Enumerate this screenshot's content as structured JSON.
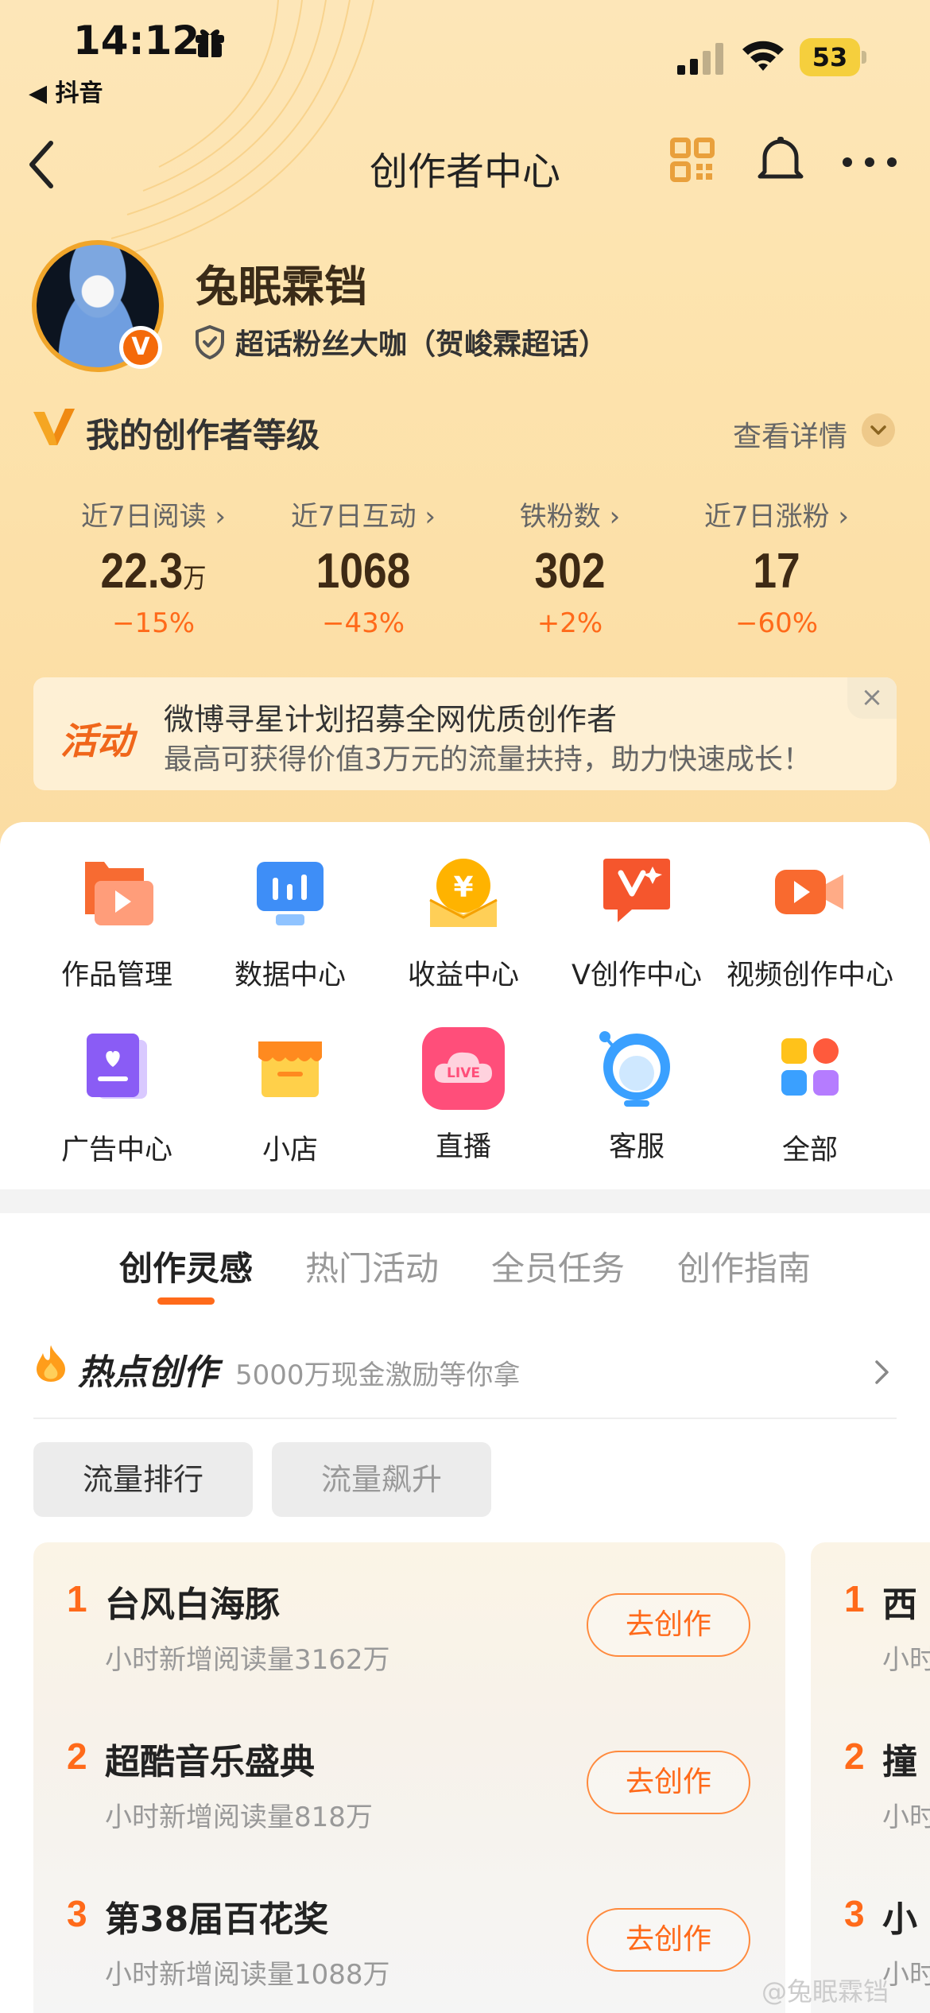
{
  "status_bar": {
    "time": "14:12",
    "back_app": "◀ 抖音",
    "battery": "53"
  },
  "nav": {
    "title": "创作者中心"
  },
  "profile": {
    "name": "兔眠霖铛",
    "verified_badge": "V",
    "fan_title": "超话粉丝大咖（贺峻霖超话）"
  },
  "level": {
    "title": "我的创作者等级",
    "detail": "查看详情"
  },
  "stats": [
    {
      "label": "近7日阅读 ›",
      "value": "22.3",
      "unit": "万",
      "change": "−15%"
    },
    {
      "label": "近7日互动 ›",
      "value": "1068",
      "unit": "",
      "change": "−43%"
    },
    {
      "label": "铁粉数 ›",
      "value": "302",
      "unit": "",
      "change": "+2%"
    },
    {
      "label": "近7日涨粉 ›",
      "value": "17",
      "unit": "",
      "change": "−60%"
    }
  ],
  "banner": {
    "tag": "活动",
    "line1": "微博寻星计划招募全网优质创作者",
    "line2": "最高可获得价值3万元的流量扶持，助力快速成长！",
    "close": "×"
  },
  "tools": [
    {
      "label": "作品管理",
      "icon": "works-icon"
    },
    {
      "label": "数据中心",
      "icon": "data-icon"
    },
    {
      "label": "收益中心",
      "icon": "income-icon"
    },
    {
      "label": "V创作中心",
      "icon": "v-create-icon"
    },
    {
      "label": "视频创作中心",
      "icon": "video-icon"
    },
    {
      "label": "广告中心",
      "icon": "ad-icon"
    },
    {
      "label": "小店",
      "icon": "shop-icon"
    },
    {
      "label": "直播",
      "icon": "live-icon",
      "icon_text": "LIVE"
    },
    {
      "label": "客服",
      "icon": "service-icon"
    },
    {
      "label": "全部",
      "icon": "all-icon"
    }
  ],
  "tabs": [
    "创作灵感",
    "热门活动",
    "全员任务",
    "创作指南"
  ],
  "hot": {
    "title": "热点创作",
    "subtitle": "5000万现金激励等你拿"
  },
  "filters": [
    "流量排行",
    "流量飙升"
  ],
  "ranking": [
    {
      "rank": "1",
      "title": "台风白海豚",
      "sub": "小时新增阅读量3162万",
      "button": "去创作"
    },
    {
      "rank": "2",
      "title": "超酷音乐盛典",
      "sub": "小时新增阅读量818万",
      "button": "去创作"
    },
    {
      "rank": "3",
      "title": "第38届百花奖",
      "sub": "小时新增阅读量1088万",
      "button": "去创作"
    }
  ],
  "ranking2": [
    {
      "rank": "1",
      "title": "西 ",
      "sub": "小时"
    },
    {
      "rank": "2",
      "title": "撞 ",
      "sub": "小时"
    },
    {
      "rank": "3",
      "title": "小 ",
      "sub": "小时"
    }
  ],
  "watermark": "@兔眠霖铛",
  "colors": {
    "accent": "#ff6a1a",
    "header_bg": "#fde3ad"
  }
}
